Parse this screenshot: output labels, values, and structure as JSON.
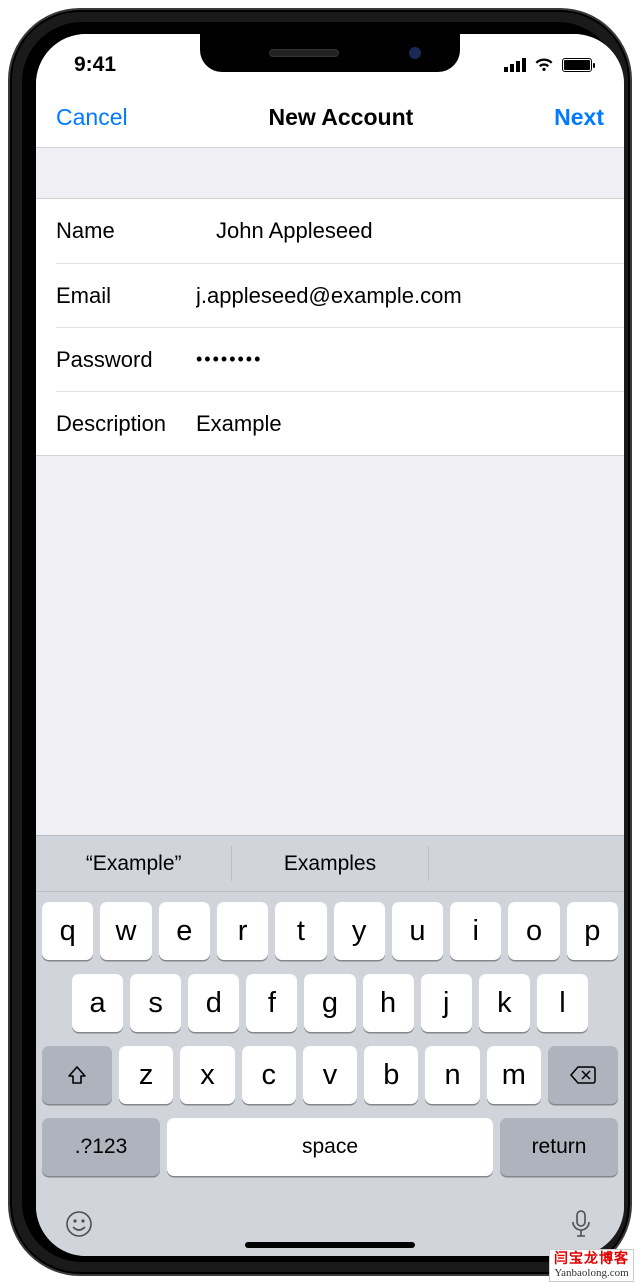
{
  "status": {
    "time": "9:41"
  },
  "nav": {
    "cancel": "Cancel",
    "title": "New Account",
    "next": "Next"
  },
  "form": {
    "name_label": "Name",
    "name_value": "John Appleseed",
    "email_label": "Email",
    "email_value": "j.appleseed@example.com",
    "password_label": "Password",
    "password_value": "••••••••",
    "description_label": "Description",
    "description_value": "Example"
  },
  "keyboard": {
    "suggestions": [
      "“Example”",
      "Examples"
    ],
    "row1": [
      "q",
      "w",
      "e",
      "r",
      "t",
      "y",
      "u",
      "i",
      "o",
      "p"
    ],
    "row2": [
      "a",
      "s",
      "d",
      "f",
      "g",
      "h",
      "j",
      "k",
      "l"
    ],
    "row3": [
      "z",
      "x",
      "c",
      "v",
      "b",
      "n",
      "m"
    ],
    "numkey": ".?123",
    "space": "space",
    "return": "return"
  },
  "watermark": {
    "line1": "闫宝龙博客",
    "line2": "Yanbaolong.com"
  }
}
